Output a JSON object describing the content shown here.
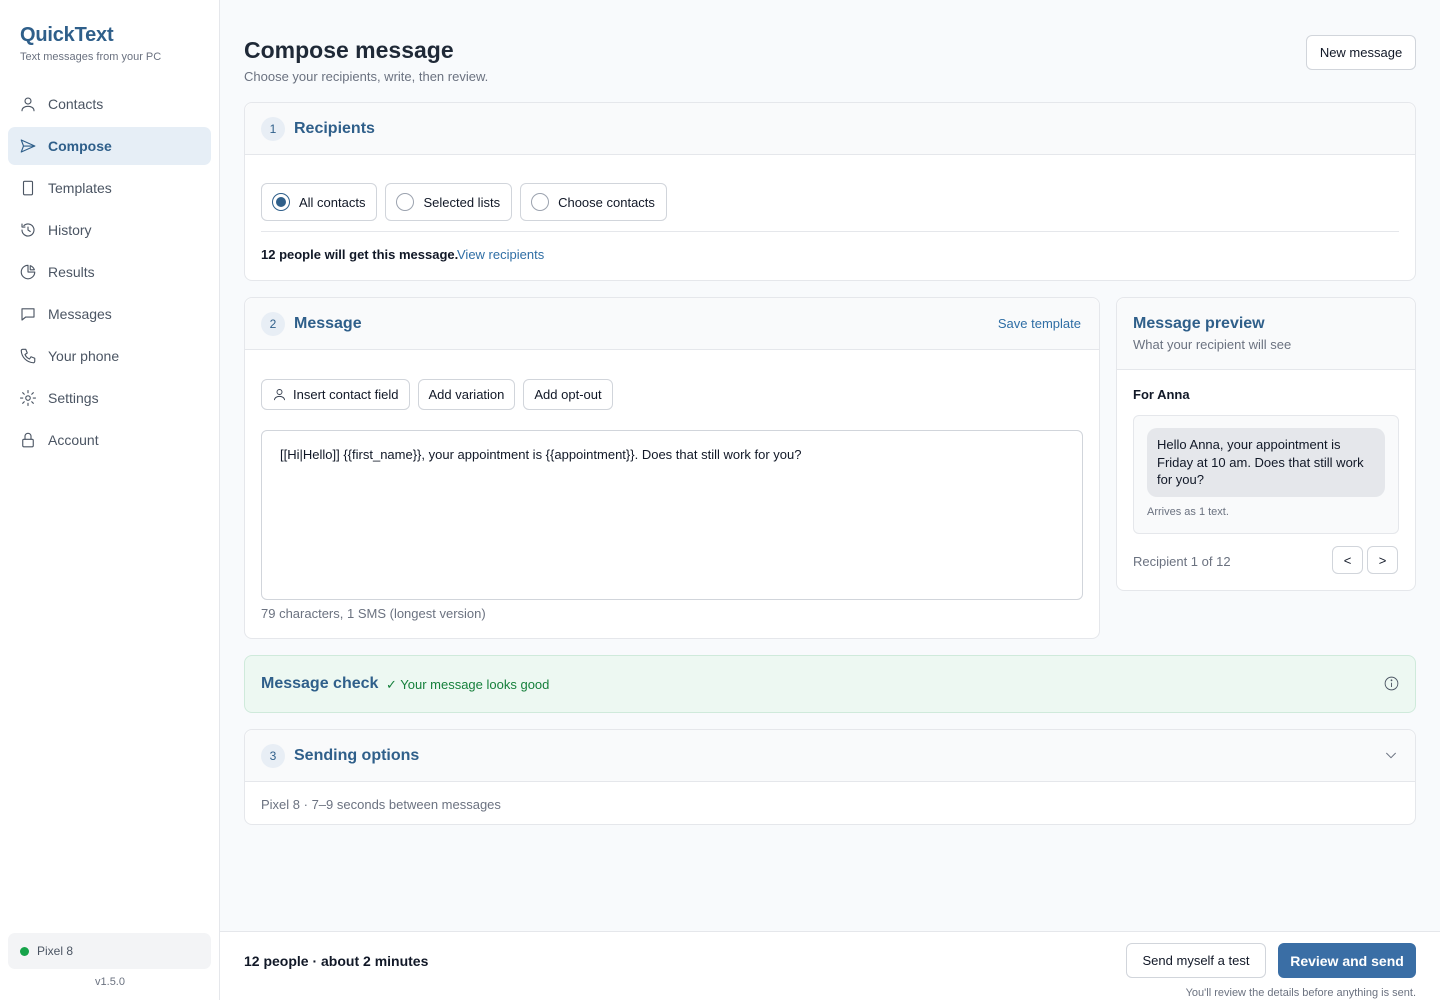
{
  "app": {
    "name": "QuickText",
    "tagline": "Text messages from your PC",
    "version": "v1.5.0"
  },
  "sidebar": {
    "items": [
      {
        "label": "Contacts",
        "icon": "person-icon",
        "active": false
      },
      {
        "label": "Compose",
        "icon": "send-icon",
        "active": true
      },
      {
        "label": "Templates",
        "icon": "document-icon",
        "active": false
      },
      {
        "label": "History",
        "icon": "history-icon",
        "active": false
      },
      {
        "label": "Results",
        "icon": "pie-chart-icon",
        "active": false
      },
      {
        "label": "Messages",
        "icon": "chat-icon",
        "active": false
      },
      {
        "label": "Your phone",
        "icon": "phone-icon",
        "active": false
      },
      {
        "label": "Settings",
        "icon": "gear-icon",
        "active": false
      },
      {
        "label": "Account",
        "icon": "lock-icon",
        "active": false
      }
    ],
    "device": {
      "name": "Pixel 8",
      "status_color": "#16a34a"
    }
  },
  "header": {
    "title": "Compose message",
    "subtitle": "Choose your recipients, write, then review.",
    "new_message_label": "New message"
  },
  "recipients": {
    "step": "1",
    "title": "Recipients",
    "options": [
      {
        "label": "All contacts",
        "checked": true
      },
      {
        "label": "Selected lists",
        "checked": false
      },
      {
        "label": "Choose contacts",
        "checked": false
      }
    ],
    "summary": "12 people will get this message.",
    "view_link": "View recipients"
  },
  "message": {
    "step": "2",
    "title": "Message",
    "save_template_label": "Save template",
    "tools": {
      "insert_field": "Insert contact field",
      "add_variation": "Add variation",
      "add_optout": "Add opt-out"
    },
    "body": "[[Hi|Hello]] {{first_name}}, your appointment is {{appointment}}. Does that still work for you?",
    "char_count": "79 characters, 1 SMS (longest version)"
  },
  "preview": {
    "title": "Message preview",
    "subtitle": "What your recipient will see",
    "for_label": "For Anna",
    "bubble_text": "Hello Anna, your appointment is Friday at 10 am. Does that still work for you?",
    "arrives": "Arrives as 1 text.",
    "nav_label": "Recipient 1 of 12",
    "prev_label": "<",
    "next_label": ">"
  },
  "check": {
    "title": "Message check",
    "status": "✓ Your message looks good"
  },
  "sending": {
    "step": "3",
    "title": "Sending options",
    "summary": "Pixel 8 · 7–9 seconds between messages"
  },
  "footer": {
    "summary": "12 people · about 2 minutes",
    "test_label": "Send myself a test",
    "review_label": "Review and send",
    "note": "You'll review the details before anything is sent."
  },
  "colors": {
    "accent": "#2f5f8a",
    "primary_button": "#3a6ea5",
    "success": "#16803c",
    "success_bg": "#edf8f2"
  }
}
